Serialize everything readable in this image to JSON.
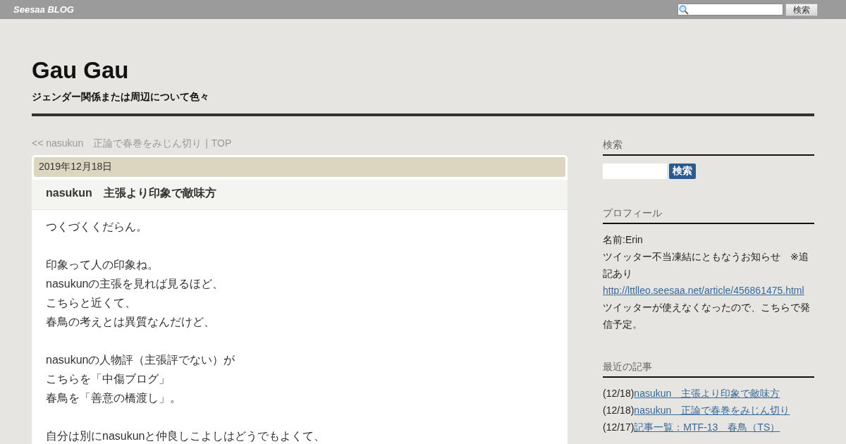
{
  "topbar": {
    "logo": "Seesaa BLOG",
    "search_button": "検索"
  },
  "blog": {
    "title": "Gau Gau",
    "subtitle": "ジェンダー関係または周辺について色々"
  },
  "breadcrumb": {
    "prev": "<< nasukun　正論で春巻をみじん切り",
    "separator": "|",
    "top": "TOP"
  },
  "article": {
    "date": "2019年12月18日",
    "title": "nasukun　主張より印象で敵味方",
    "paragraphs": [
      [
        "つくづくくだらん。"
      ],
      [
        "印象って人の印象ね。",
        "nasukunの主張を見れば見るほど、",
        "こちらと近くて、",
        "春鳥の考えとは異質なんだけど、"
      ],
      [
        "nasukunの人物評（主張評でない）が",
        "こちらを「中傷ブログ」",
        "春鳥を「善意の橋渡し」。"
      ],
      [
        "自分は別にnasukunと仲良しこよしはどうでもよくて、"
      ]
    ]
  },
  "sidebar": {
    "search": {
      "heading": "検索",
      "button": "検索"
    },
    "profile": {
      "heading": "プロフィール",
      "name": "名前:Erin",
      "notice": "ツイッター不当凍結にともなうお知らせ　※追記あり",
      "link": "http://lttlleo.seesaa.net/article/456861475.html",
      "note": "ツイッターが使えなくなったので、こちらで発信予定。"
    },
    "recent": {
      "heading": "最近の記事",
      "items": [
        {
          "date": "(12/18)",
          "title": "nasukun　主張より印象で敵味方"
        },
        {
          "date": "(12/18)",
          "title": "nasukun　正論で春巻をみじん切り"
        },
        {
          "date": "(12/17)",
          "title": "記事一覧：MTF-13　春鳥（TS）"
        }
      ]
    }
  }
}
